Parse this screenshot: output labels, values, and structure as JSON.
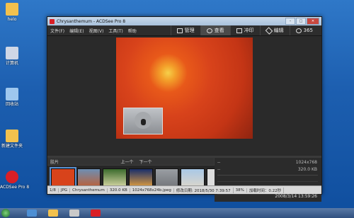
{
  "desktop": {
    "icons": [
      {
        "label": "helo",
        "color": "#f2c14e"
      },
      {
        "label": "计算机",
        "color": "#cfd7e6"
      },
      {
        "label": "回收站",
        "color": "#9ec7ee"
      },
      {
        "label": "新建文件夹",
        "color": "#f2c14e"
      },
      {
        "label": "ACDSee Pro 8",
        "color": "#d81f26"
      }
    ]
  },
  "window": {
    "title": "Chrysanthemum - ACDSee Pro 8",
    "controls": {
      "minimize": "–",
      "maximize": "□",
      "close": "✕"
    },
    "menu": [
      "文件(F)",
      "编辑(E)",
      "视图(V)",
      "工具(T)",
      "帮助"
    ],
    "modes": [
      {
        "label": "管理",
        "icon": "grid-icon"
      },
      {
        "label": "查看",
        "icon": "eye-icon",
        "active": true
      },
      {
        "label": "冲印",
        "icon": "develop-icon"
      },
      {
        "label": "编辑",
        "icon": "edit-icon"
      },
      {
        "label": "365",
        "icon": "cloud-icon"
      }
    ],
    "filmstrip": {
      "label": "胶片",
      "prev": "上一个",
      "next": "下一个"
    },
    "info": {
      "resolution": "1024x768",
      "size": "320.0 KB",
      "dash1": "--",
      "dash2": "--",
      "date": "2008/3/14  13:59:26"
    },
    "status": {
      "index": "1/8",
      "format": "JPG",
      "name": "Chrysanthemum",
      "size": "320.0 KB",
      "dims": "1024x768x24b.jpeg",
      "modified": "修改日期: 2018/5/30 7:39:57",
      "zoom": "38%",
      "load": "加载时间：0.22秒"
    }
  },
  "colors": {
    "accent": "#d81f26",
    "photo": "#d8431b"
  }
}
